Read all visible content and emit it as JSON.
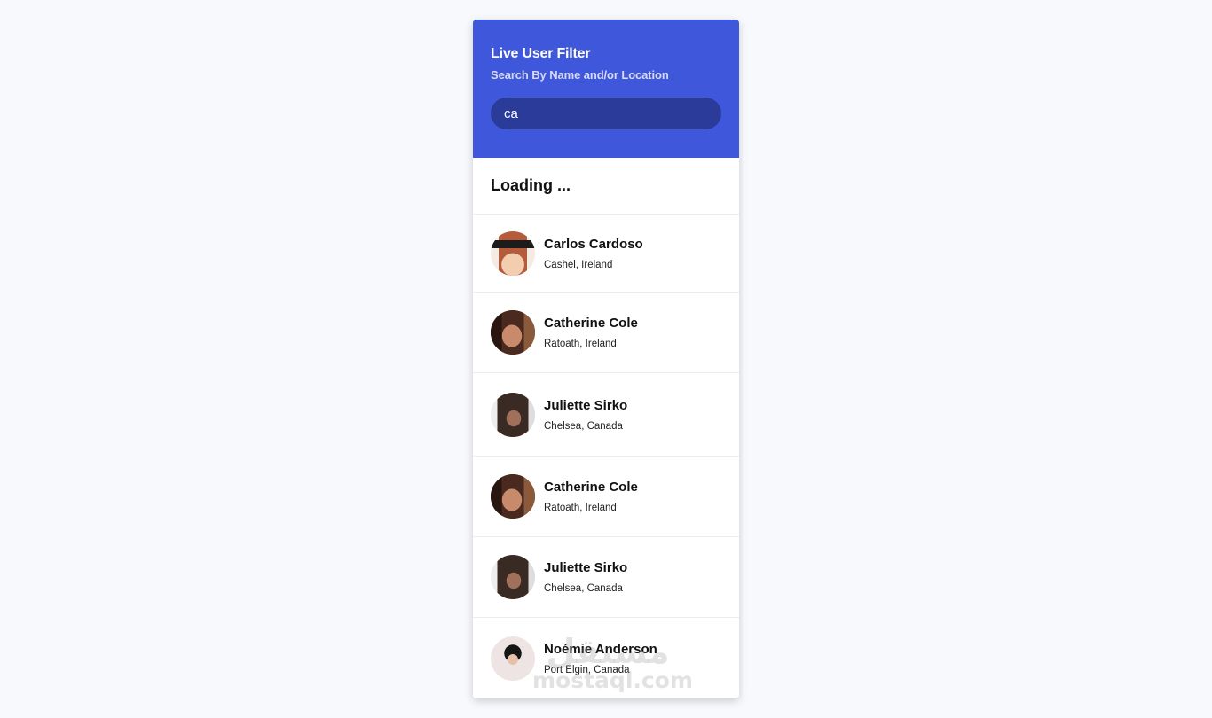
{
  "header": {
    "title": "Live User Filter",
    "subtitle": "Search By Name and/or Location",
    "search_value": "ca",
    "search_placeholder": "Search",
    "accent_color": "#3f57db"
  },
  "status": {
    "loading_text": "Loading ..."
  },
  "users": [
    {
      "name": "Carlos Cardoso",
      "location": "Cashel, Ireland",
      "avatar": "user-photo-icon"
    },
    {
      "name": "Catherine Cole",
      "location": "Ratoath, Ireland",
      "avatar": "user-photo-icon"
    },
    {
      "name": "Juliette Sirko",
      "location": "Chelsea, Canada",
      "avatar": "user-photo-icon"
    },
    {
      "name": "Catherine Cole",
      "location": "Ratoath, Ireland",
      "avatar": "user-photo-icon"
    },
    {
      "name": "Juliette Sirko",
      "location": "Chelsea, Canada",
      "avatar": "user-photo-icon"
    },
    {
      "name": "Noémie Anderson",
      "location": "Port Elgin, Canada",
      "avatar": "user-photo-icon"
    }
  ],
  "watermark": {
    "arabic": "مستقل",
    "latin": "mostaql.com"
  }
}
